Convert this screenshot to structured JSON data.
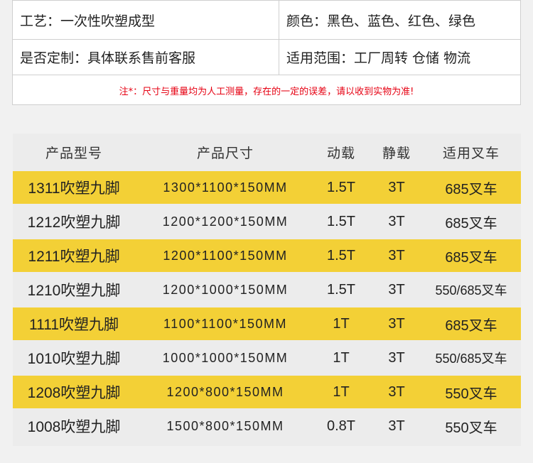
{
  "info": {
    "process_label": "工艺：一次性吹塑成型",
    "color_label": "颜色：黑色、蓝色、红色、绿色",
    "custom_label": "是否定制：具体联系售前客服",
    "scope_label": "适用范围：工厂周转 仓储 物流",
    "note": "注*：尺寸与重量均为人工测量，存在的一定的误差，请以收到实物为准!"
  },
  "chart_data": {
    "type": "table",
    "columns": [
      "产品型号",
      "产品尺寸",
      "动载",
      "静载",
      "适用叉车"
    ],
    "rows": [
      [
        "1311吹塑九脚",
        "1300*1100*150MM",
        "1.5T",
        "3T",
        "685叉车"
      ],
      [
        "1212吹塑九脚",
        "1200*1200*150MM",
        "1.5T",
        "3T",
        "685叉车"
      ],
      [
        "1211吹塑九脚",
        "1200*1100*150MM",
        "1.5T",
        "3T",
        "685叉车"
      ],
      [
        "1210吹塑九脚",
        "1200*1000*150MM",
        "1.5T",
        "3T",
        "550/685叉车"
      ],
      [
        "1111吹塑九脚",
        "1100*1100*150MM",
        "1T",
        "3T",
        "685叉车"
      ],
      [
        "1010吹塑九脚",
        "1000*1000*150MM",
        "1T",
        "3T",
        "550/685叉车"
      ],
      [
        "1208吹塑九脚",
        "1200*800*150MM",
        "1T",
        "3T",
        "550叉车"
      ],
      [
        "1008吹塑九脚",
        "1500*800*150MM",
        "0.8T",
        "3T",
        "550叉车"
      ]
    ],
    "highlight_rows": [
      0,
      2,
      4,
      6
    ],
    "colors": {
      "highlight": "#f3d036",
      "table_bg": "#ececec",
      "note": "#e60012"
    }
  }
}
